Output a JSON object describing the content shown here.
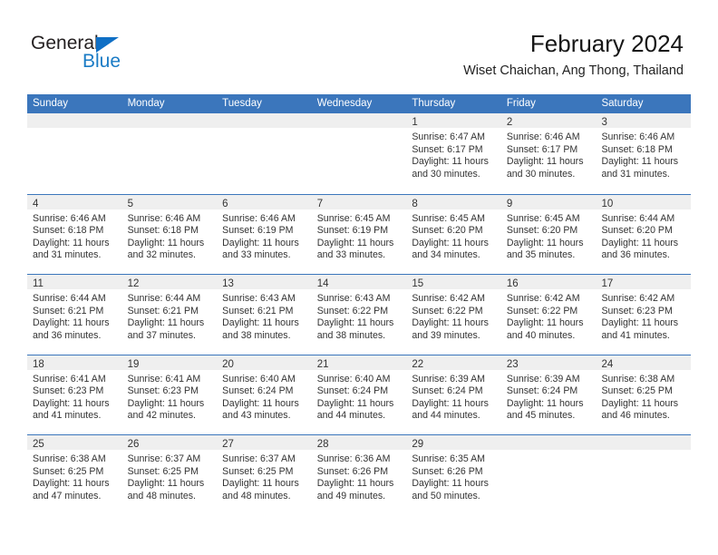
{
  "brand": {
    "name_top": "General",
    "name_bottom": "Blue",
    "triangle_color": "#0f6fc5",
    "text_color": "#231f20",
    "blue_color": "#1a7bc5"
  },
  "header": {
    "title": "February 2024",
    "subtitle": "Wiset Chaichan, Ang Thong, Thailand"
  },
  "theme": {
    "header_blue": "#3b76bc",
    "day_band_gray": "#efefef",
    "text": "#333333"
  },
  "weekdays": [
    "Sunday",
    "Monday",
    "Tuesday",
    "Wednesday",
    "Thursday",
    "Friday",
    "Saturday"
  ],
  "weeks": [
    [
      {
        "day": "",
        "lines": []
      },
      {
        "day": "",
        "lines": []
      },
      {
        "day": "",
        "lines": []
      },
      {
        "day": "",
        "lines": []
      },
      {
        "day": "1",
        "lines": [
          "Sunrise: 6:47 AM",
          "Sunset: 6:17 PM",
          "Daylight: 11 hours",
          "and 30 minutes."
        ]
      },
      {
        "day": "2",
        "lines": [
          "Sunrise: 6:46 AM",
          "Sunset: 6:17 PM",
          "Daylight: 11 hours",
          "and 30 minutes."
        ]
      },
      {
        "day": "3",
        "lines": [
          "Sunrise: 6:46 AM",
          "Sunset: 6:18 PM",
          "Daylight: 11 hours",
          "and 31 minutes."
        ]
      }
    ],
    [
      {
        "day": "4",
        "lines": [
          "Sunrise: 6:46 AM",
          "Sunset: 6:18 PM",
          "Daylight: 11 hours",
          "and 31 minutes."
        ]
      },
      {
        "day": "5",
        "lines": [
          "Sunrise: 6:46 AM",
          "Sunset: 6:18 PM",
          "Daylight: 11 hours",
          "and 32 minutes."
        ]
      },
      {
        "day": "6",
        "lines": [
          "Sunrise: 6:46 AM",
          "Sunset: 6:19 PM",
          "Daylight: 11 hours",
          "and 33 minutes."
        ]
      },
      {
        "day": "7",
        "lines": [
          "Sunrise: 6:45 AM",
          "Sunset: 6:19 PM",
          "Daylight: 11 hours",
          "and 33 minutes."
        ]
      },
      {
        "day": "8",
        "lines": [
          "Sunrise: 6:45 AM",
          "Sunset: 6:20 PM",
          "Daylight: 11 hours",
          "and 34 minutes."
        ]
      },
      {
        "day": "9",
        "lines": [
          "Sunrise: 6:45 AM",
          "Sunset: 6:20 PM",
          "Daylight: 11 hours",
          "and 35 minutes."
        ]
      },
      {
        "day": "10",
        "lines": [
          "Sunrise: 6:44 AM",
          "Sunset: 6:20 PM",
          "Daylight: 11 hours",
          "and 36 minutes."
        ]
      }
    ],
    [
      {
        "day": "11",
        "lines": [
          "Sunrise: 6:44 AM",
          "Sunset: 6:21 PM",
          "Daylight: 11 hours",
          "and 36 minutes."
        ]
      },
      {
        "day": "12",
        "lines": [
          "Sunrise: 6:44 AM",
          "Sunset: 6:21 PM",
          "Daylight: 11 hours",
          "and 37 minutes."
        ]
      },
      {
        "day": "13",
        "lines": [
          "Sunrise: 6:43 AM",
          "Sunset: 6:21 PM",
          "Daylight: 11 hours",
          "and 38 minutes."
        ]
      },
      {
        "day": "14",
        "lines": [
          "Sunrise: 6:43 AM",
          "Sunset: 6:22 PM",
          "Daylight: 11 hours",
          "and 38 minutes."
        ]
      },
      {
        "day": "15",
        "lines": [
          "Sunrise: 6:42 AM",
          "Sunset: 6:22 PM",
          "Daylight: 11 hours",
          "and 39 minutes."
        ]
      },
      {
        "day": "16",
        "lines": [
          "Sunrise: 6:42 AM",
          "Sunset: 6:22 PM",
          "Daylight: 11 hours",
          "and 40 minutes."
        ]
      },
      {
        "day": "17",
        "lines": [
          "Sunrise: 6:42 AM",
          "Sunset: 6:23 PM",
          "Daylight: 11 hours",
          "and 41 minutes."
        ]
      }
    ],
    [
      {
        "day": "18",
        "lines": [
          "Sunrise: 6:41 AM",
          "Sunset: 6:23 PM",
          "Daylight: 11 hours",
          "and 41 minutes."
        ]
      },
      {
        "day": "19",
        "lines": [
          "Sunrise: 6:41 AM",
          "Sunset: 6:23 PM",
          "Daylight: 11 hours",
          "and 42 minutes."
        ]
      },
      {
        "day": "20",
        "lines": [
          "Sunrise: 6:40 AM",
          "Sunset: 6:24 PM",
          "Daylight: 11 hours",
          "and 43 minutes."
        ]
      },
      {
        "day": "21",
        "lines": [
          "Sunrise: 6:40 AM",
          "Sunset: 6:24 PM",
          "Daylight: 11 hours",
          "and 44 minutes."
        ]
      },
      {
        "day": "22",
        "lines": [
          "Sunrise: 6:39 AM",
          "Sunset: 6:24 PM",
          "Daylight: 11 hours",
          "and 44 minutes."
        ]
      },
      {
        "day": "23",
        "lines": [
          "Sunrise: 6:39 AM",
          "Sunset: 6:24 PM",
          "Daylight: 11 hours",
          "and 45 minutes."
        ]
      },
      {
        "day": "24",
        "lines": [
          "Sunrise: 6:38 AM",
          "Sunset: 6:25 PM",
          "Daylight: 11 hours",
          "and 46 minutes."
        ]
      }
    ],
    [
      {
        "day": "25",
        "lines": [
          "Sunrise: 6:38 AM",
          "Sunset: 6:25 PM",
          "Daylight: 11 hours",
          "and 47 minutes."
        ]
      },
      {
        "day": "26",
        "lines": [
          "Sunrise: 6:37 AM",
          "Sunset: 6:25 PM",
          "Daylight: 11 hours",
          "and 48 minutes."
        ]
      },
      {
        "day": "27",
        "lines": [
          "Sunrise: 6:37 AM",
          "Sunset: 6:25 PM",
          "Daylight: 11 hours",
          "and 48 minutes."
        ]
      },
      {
        "day": "28",
        "lines": [
          "Sunrise: 6:36 AM",
          "Sunset: 6:26 PM",
          "Daylight: 11 hours",
          "and 49 minutes."
        ]
      },
      {
        "day": "29",
        "lines": [
          "Sunrise: 6:35 AM",
          "Sunset: 6:26 PM",
          "Daylight: 11 hours",
          "and 50 minutes."
        ]
      },
      {
        "day": "",
        "lines": []
      },
      {
        "day": "",
        "lines": []
      }
    ]
  ]
}
